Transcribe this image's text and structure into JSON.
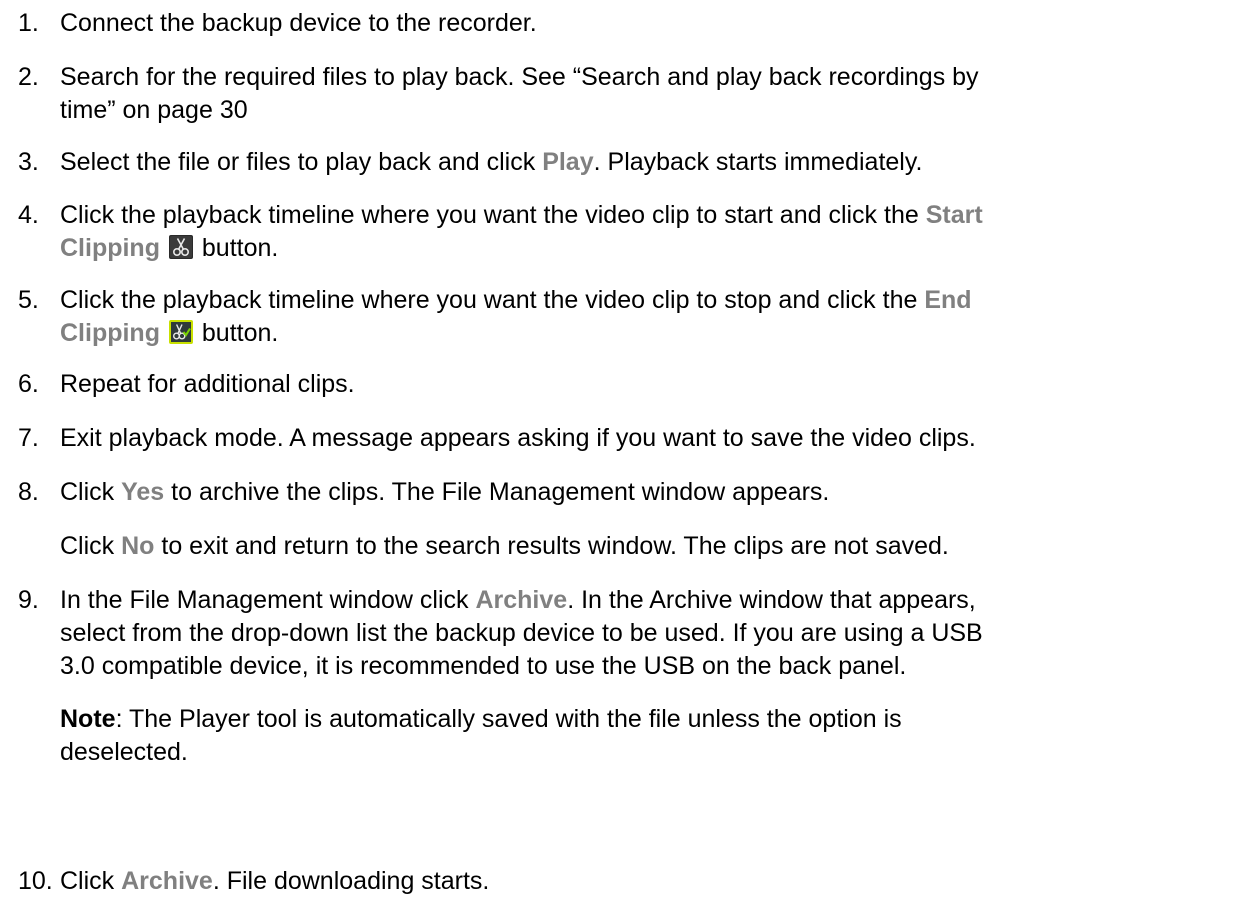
{
  "steps": [
    {
      "num": "1.",
      "text": "Connect the backup device to the recorder."
    },
    {
      "num": "2.",
      "line1": "Search for the required files to play back. See “Search and play back recordings by",
      "line2": "time” on page 30"
    },
    {
      "num": "3.",
      "pre": "Select the file or files to play back and click ",
      "ui": "Play",
      "post": ". Playback starts immediately."
    },
    {
      "num": "4.",
      "pre": "Click the playback timeline where you want the video clip to start and click the ",
      "ui1": "Start",
      "ui2": "Clipping",
      "post": " button."
    },
    {
      "num": "5.",
      "pre": "Click the playback timeline where you want the video clip to stop and click the ",
      "ui1": "End",
      "ui2": "Clipping",
      "post": " button."
    },
    {
      "num": "6.",
      "text": "Repeat for additional clips."
    },
    {
      "num": "7.",
      "text": "Exit playback mode. A message appears asking if you want to save the video clips."
    },
    {
      "num": "8.",
      "pre": "Click ",
      "ui": "Yes",
      "post": " to archive the clips. The File Management window appears."
    },
    {
      "num": "9.",
      "pre": "In the File Management window click ",
      "ui": "Archive",
      "post": ".  In the Archive window that appears,",
      "line2": "select from the drop-down list the backup device to be used. If you are using a USB",
      "line3": "3.0 compatible device, it is recommended to use the USB on the back panel."
    },
    {
      "num": "10.",
      "pre": "Click ",
      "ui": "Archive",
      "post": ". File downloading starts."
    }
  ],
  "step8_note": {
    "pre": "Click ",
    "ui": "No",
    "post": " to exit and return to the search results window. The clips are not saved."
  },
  "step9_note": {
    "label": "Note",
    "line1": ": The Player tool is automatically saved with the file unless the option is",
    "line2": "deselected."
  },
  "icons": {
    "start_clipping": "scissors-icon",
    "end_clipping": "scissors-check-icon"
  },
  "colors": {
    "ui_label": "#808080",
    "text": "#000000",
    "end_icon_border": "#c8e000"
  }
}
